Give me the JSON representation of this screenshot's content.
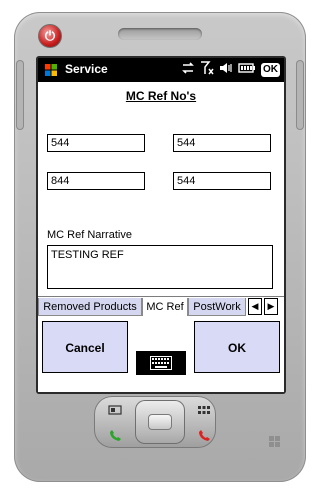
{
  "window": {
    "app_title": "Service",
    "heading": "MC Ref No's"
  },
  "status_icons": [
    "connectivity-icon",
    "no-signal-icon",
    "speaker-mute-icon",
    "battery-icon",
    "ok-icon"
  ],
  "status_ok_label": "OK",
  "fields": {
    "row1_left": "544",
    "row1_right": "544",
    "row2_left": "844",
    "row2_right": "544"
  },
  "narrative": {
    "label": "MC Ref Narrative",
    "value": "TESTING REF"
  },
  "tabs": [
    {
      "label": "Removed Products",
      "active": false
    },
    {
      "label": "MC Ref",
      "active": true
    },
    {
      "label": "PostWork",
      "active": false
    }
  ],
  "softkeys": {
    "left": "Cancel",
    "right": "OK"
  },
  "colors": {
    "titlebar": "#000000",
    "softkey_bg": "#d9daf6",
    "tab_inactive_bg": "#d5d7f0"
  }
}
